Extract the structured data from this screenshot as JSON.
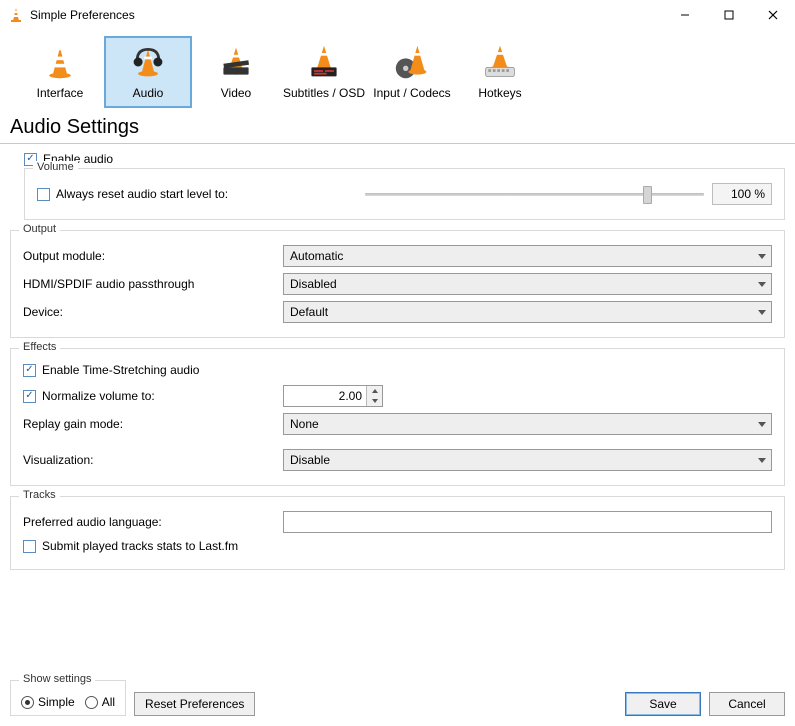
{
  "window": {
    "title": "Simple Preferences"
  },
  "categories": {
    "interface": "Interface",
    "audio": "Audio",
    "video": "Video",
    "subtitles": "Subtitles / OSD",
    "input_codecs": "Input / Codecs",
    "hotkeys": "Hotkeys",
    "selected": "audio"
  },
  "page_heading": "Audio Settings",
  "enable_audio": {
    "label": "Enable audio",
    "checked": true
  },
  "volume": {
    "group_title": "Volume",
    "always_reset": {
      "label": "Always reset audio start level to:",
      "checked": false
    },
    "slider_pct": 82,
    "pct_display": "100 %"
  },
  "output": {
    "group_title": "Output",
    "module": {
      "label": "Output module:",
      "value": "Automatic"
    },
    "hdmi": {
      "label": "HDMI/SPDIF audio passthrough",
      "value": "Disabled"
    },
    "device": {
      "label": "Device:",
      "value": "Default"
    }
  },
  "effects": {
    "group_title": "Effects",
    "time_stretch": {
      "label": "Enable Time-Stretching audio",
      "checked": true
    },
    "normalize": {
      "label": "Normalize volume to:",
      "checked": true,
      "value": "2.00"
    },
    "replay_gain": {
      "label": "Replay gain mode:",
      "value": "None"
    },
    "visualization": {
      "label": "Visualization:",
      "value": "Disable"
    }
  },
  "tracks": {
    "group_title": "Tracks",
    "pref_lang": {
      "label": "Preferred audio language:",
      "value": ""
    },
    "lastfm": {
      "label": "Submit played tracks stats to Last.fm",
      "checked": false
    }
  },
  "footer": {
    "show_settings_title": "Show settings",
    "simple": "Simple",
    "all": "All",
    "mode": "simple",
    "reset": "Reset Preferences",
    "save": "Save",
    "cancel": "Cancel"
  }
}
